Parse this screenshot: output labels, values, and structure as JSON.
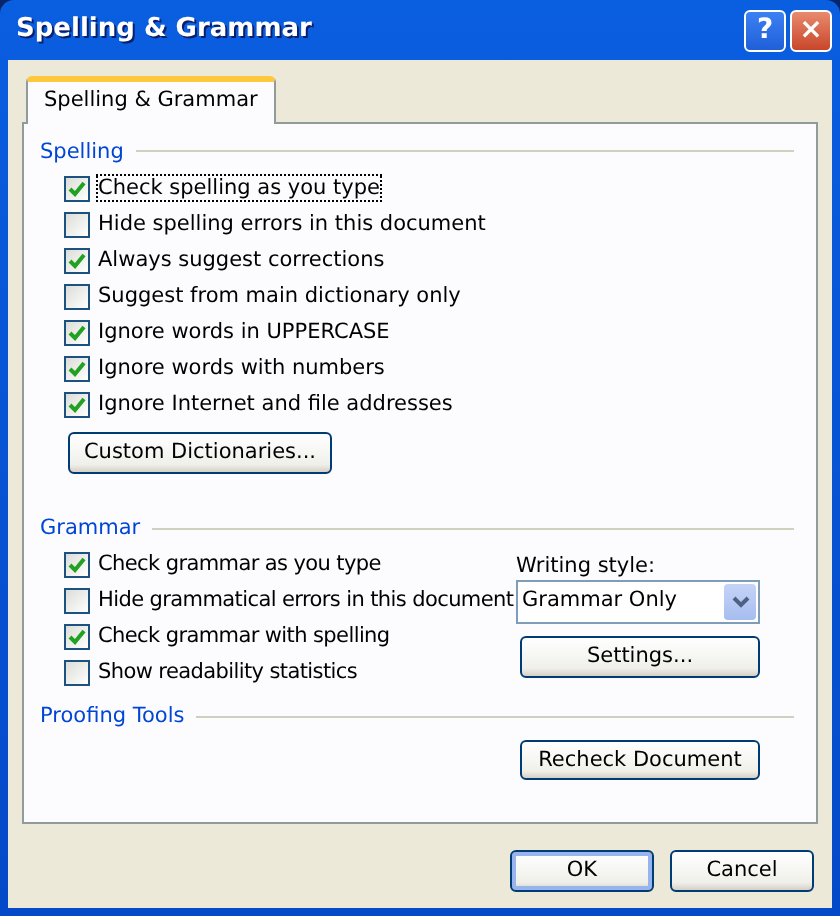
{
  "window": {
    "title": "Spelling & Grammar",
    "title_buttons": [
      "?",
      "×"
    ]
  },
  "tabs": [
    {
      "label": "Spelling & Grammar",
      "selected": true
    }
  ],
  "spelling": {
    "heading": "Spelling",
    "options": [
      {
        "label": "Check spelling as you type",
        "checked": true,
        "focused": true
      },
      {
        "label": "Hide spelling errors in this document",
        "checked": false
      },
      {
        "label": "Always suggest corrections",
        "checked": true
      },
      {
        "label": "Suggest from main dictionary only",
        "checked": false
      },
      {
        "label": "Ignore words in UPPERCASE",
        "checked": true
      },
      {
        "label": "Ignore words with numbers",
        "checked": true
      },
      {
        "label": "Ignore Internet and file addresses",
        "checked": true
      }
    ],
    "button": "Custom Dictionaries..."
  },
  "grammar": {
    "heading": "Grammar",
    "options": [
      {
        "label": "Check grammar as you type",
        "checked": true
      },
      {
        "label": "Hide grammatical errors in this document",
        "checked": false
      },
      {
        "label": "Check grammar with spelling",
        "checked": true
      },
      {
        "label": "Show readability statistics",
        "checked": false
      }
    ],
    "writing_style": {
      "label": "Writing style:",
      "value": "Grammar Only"
    },
    "button": "Settings..."
  },
  "proofing_tools": {
    "heading": "Proofing Tools",
    "button": "Recheck Document"
  },
  "buttons": [
    "OK",
    "Cancel"
  ]
}
